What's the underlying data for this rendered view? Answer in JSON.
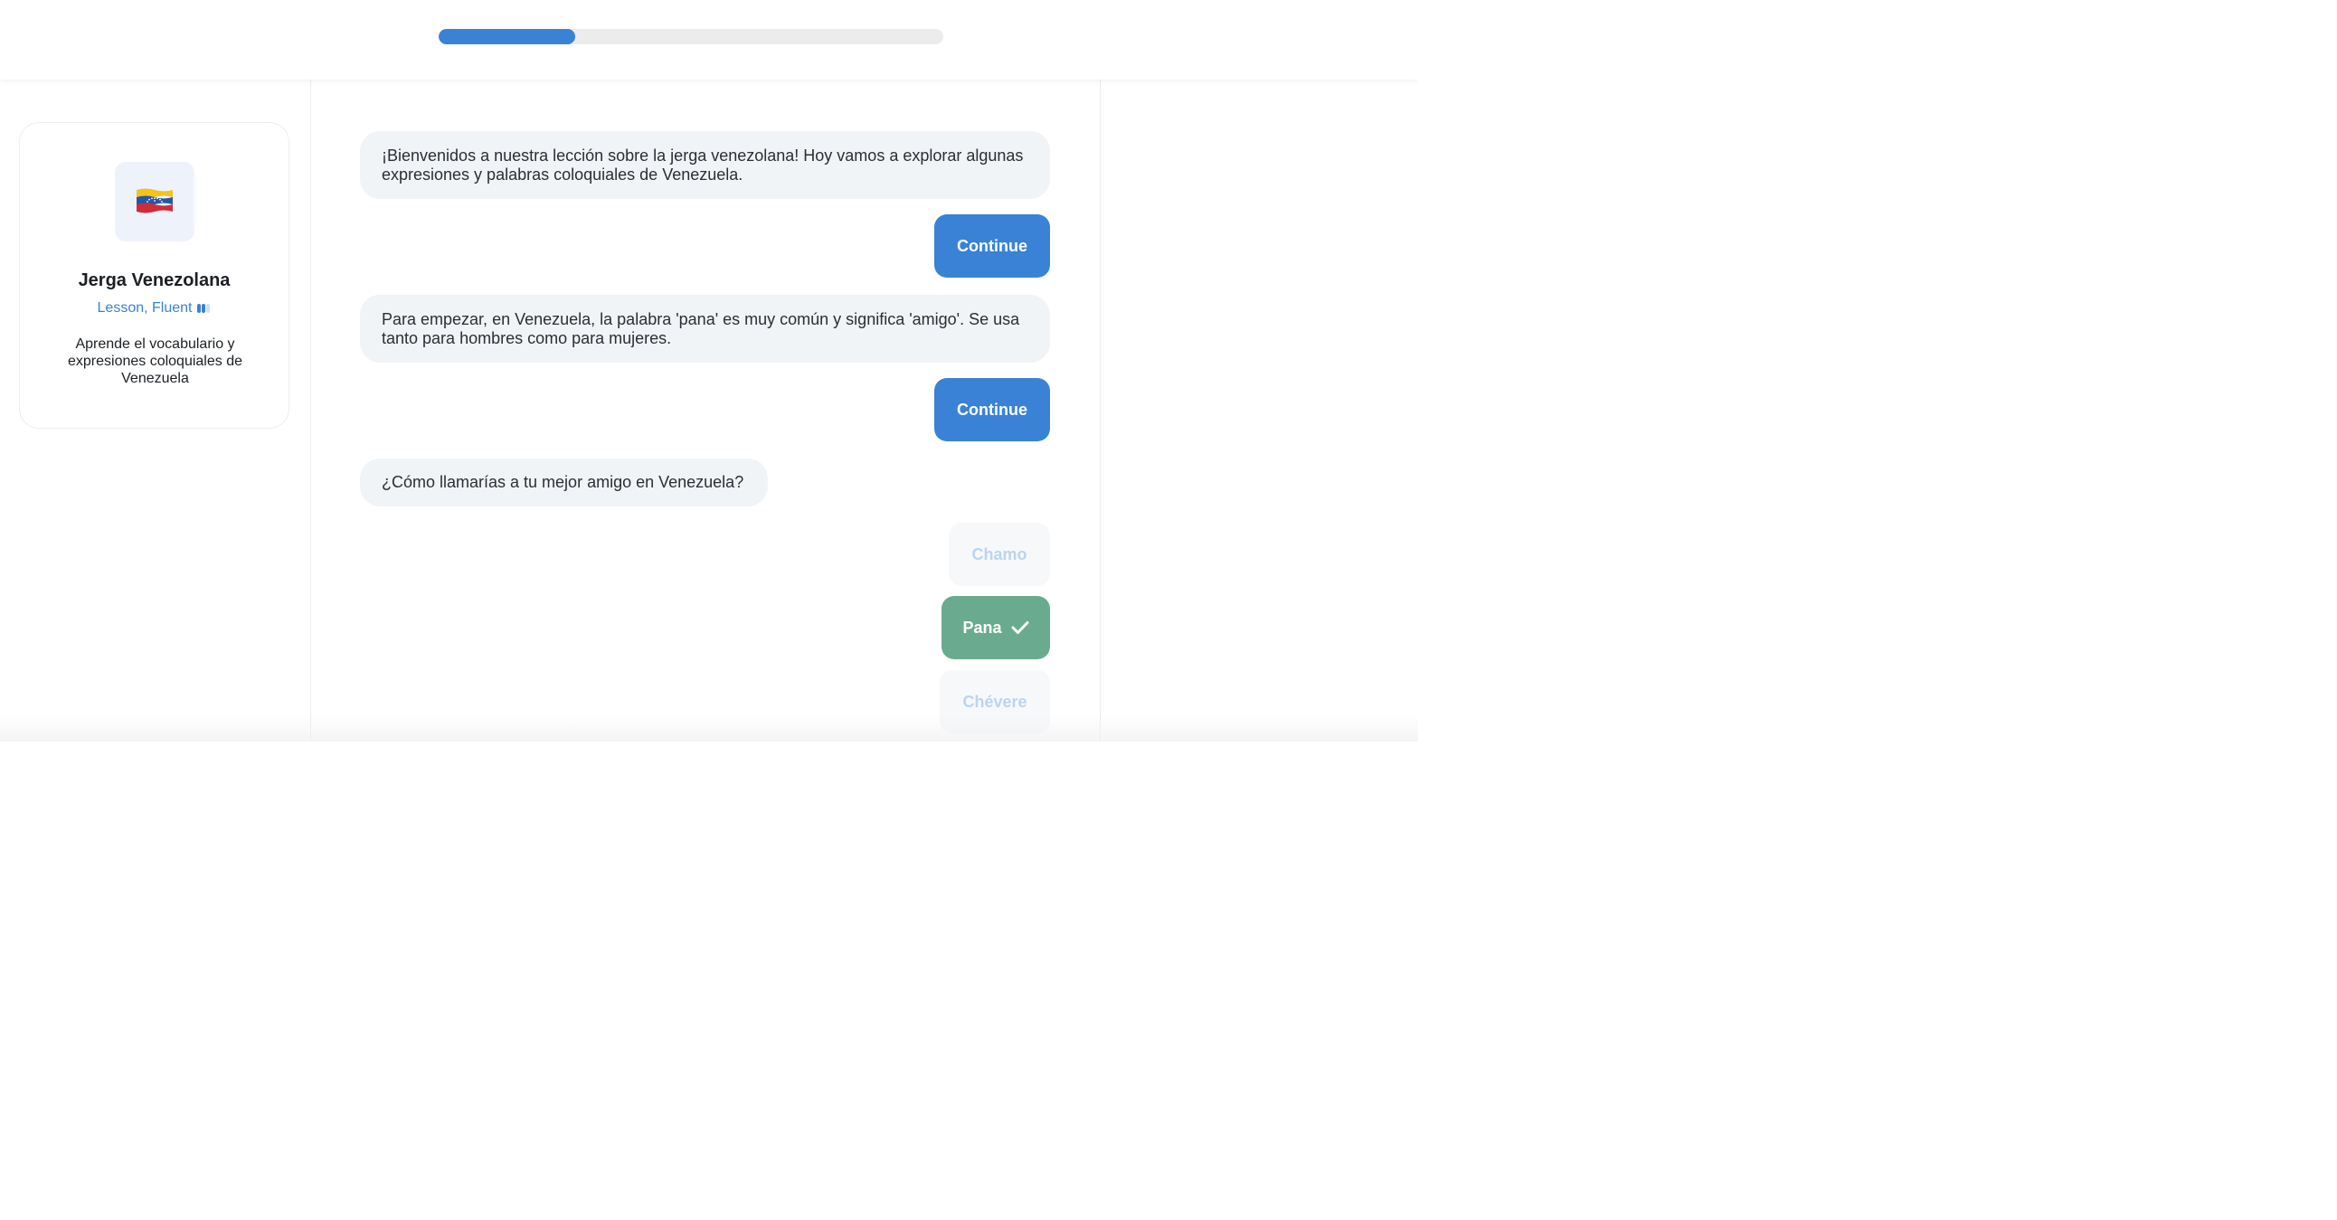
{
  "header": {
    "progress_fraction": 0.27
  },
  "lesson": {
    "icon": "venezuela-flag",
    "title": "Jerga Venezolana",
    "meta": "Lesson, Fluent",
    "level": {
      "filled": 2,
      "total": 3
    },
    "description": "Aprende el vocabulario y expresiones coloquiales de Venezuela"
  },
  "chat": {
    "messages": [
      "¡Bienvenidos a nuestra lección sobre la jerga venezolana! Hoy vamos a explorar algunas expresiones y palabras coloquiales de Venezuela.",
      "Para empezar, en Venezuela, la palabra 'pana' es muy común y significa 'amigo'. Se usa tanto para hombres como para mujeres.",
      "¿Cómo llamarías a tu mejor amigo en Venezuela?"
    ],
    "continue_label": "Continue",
    "options": [
      {
        "label": "Chamo",
        "state": "dimmed"
      },
      {
        "label": "Pana",
        "state": "correct"
      },
      {
        "label": "Chévere",
        "state": "dimmed"
      }
    ]
  },
  "colors": {
    "accent": "#3a82d6",
    "correct": "#6aab8f",
    "bubble": "#f1f4f6",
    "dimmed_text": "#bcd4ee"
  }
}
